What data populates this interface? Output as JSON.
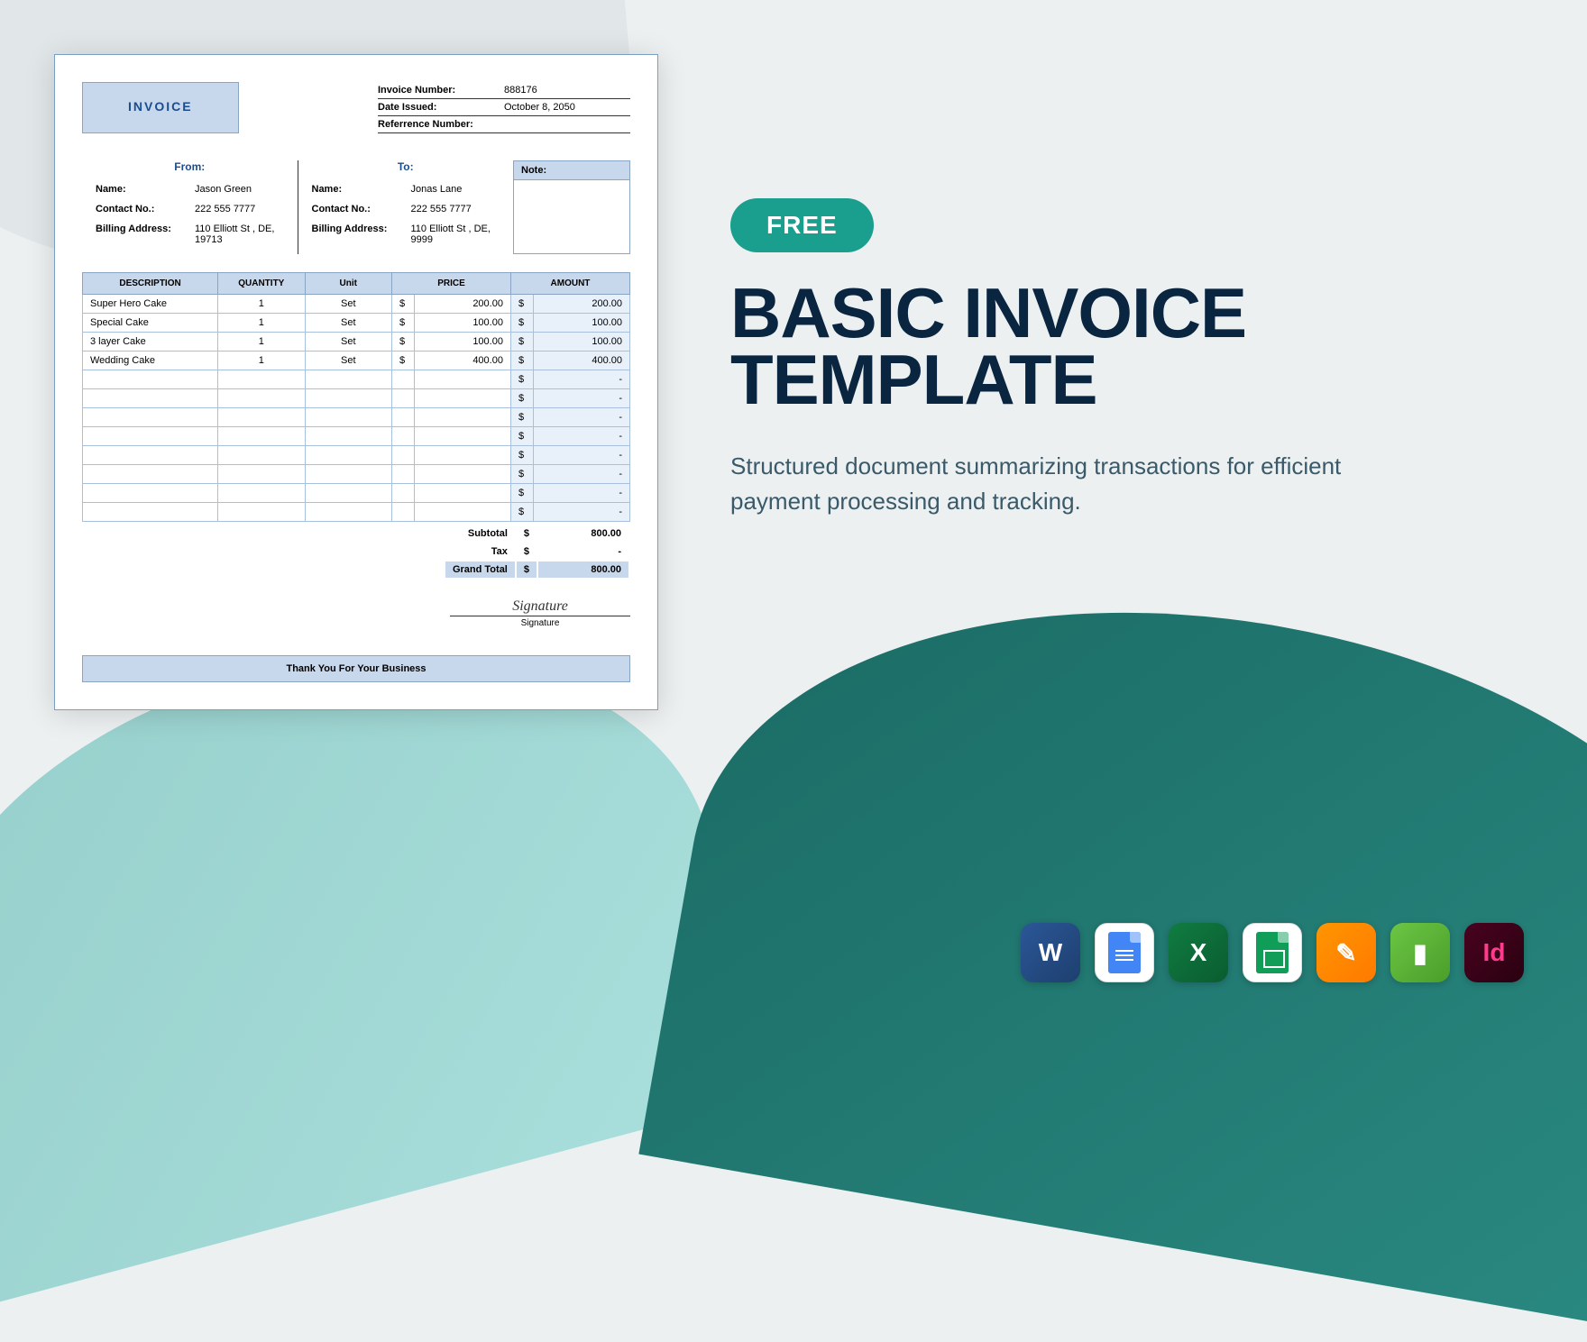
{
  "invoice": {
    "title": "INVOICE",
    "meta": {
      "number_label": "Invoice Number:",
      "number_value": "888176",
      "date_label": "Date Issued:",
      "date_value": "October 8, 2050",
      "ref_label": "Referrence Number:",
      "ref_value": ""
    },
    "from": {
      "header": "From:",
      "name_label": "Name:",
      "name_value": "Jason Green",
      "contact_label": "Contact No.:",
      "contact_value": "222 555 7777",
      "address_label": "Billing Address:",
      "address_value": "110 Elliott St , DE, 19713"
    },
    "to": {
      "header": "To:",
      "name_label": "Name:",
      "name_value": "Jonas Lane",
      "contact_label": "Contact No.:",
      "contact_value": "222 555 7777",
      "address_label": "Billing Address:",
      "address_value": "110 Elliott St , DE, 9999"
    },
    "note_label": "Note:",
    "columns": {
      "description": "DESCRIPTION",
      "quantity": "QUANTITY",
      "unit": "Unit",
      "price": "PRICE",
      "amount": "AMOUNT"
    },
    "currency": "$",
    "items": [
      {
        "desc": "Super Hero Cake",
        "qty": "1",
        "unit": "Set",
        "price": "200.00",
        "amount": "200.00"
      },
      {
        "desc": "Special Cake",
        "qty": "1",
        "unit": "Set",
        "price": "100.00",
        "amount": "100.00"
      },
      {
        "desc": "3 layer Cake",
        "qty": "1",
        "unit": "Set",
        "price": "100.00",
        "amount": "100.00"
      },
      {
        "desc": "Wedding Cake",
        "qty": "1",
        "unit": "Set",
        "price": "400.00",
        "amount": "400.00"
      }
    ],
    "empty_rows": 8,
    "dash": "-",
    "totals": {
      "subtotal_label": "Subtotal",
      "subtotal_value": "800.00",
      "tax_label": "Tax",
      "tax_value": "-",
      "grand_label": "Grand Total",
      "grand_value": "800.00"
    },
    "signature_label": "Signature",
    "footer": "Thank You For Your Business"
  },
  "promo": {
    "badge": "FREE",
    "title": "BASIC INVOICE TEMPLATE",
    "description": "Structured document summarizing transactions for efficient payment processing and tracking."
  },
  "icons": {
    "word": "W",
    "excel": "X",
    "pages": "✎",
    "numbers": "▮",
    "indesign": "Id"
  }
}
